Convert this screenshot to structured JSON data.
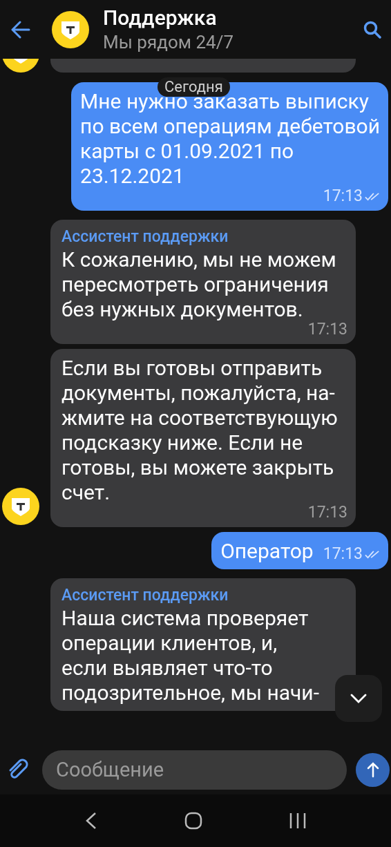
{
  "header": {
    "title": "Поддержка",
    "subtitle": "Мы рядом 24/7"
  },
  "date_divider": "Сегодня",
  "messages": [
    {
      "kind": "partial",
      "avatar": true
    },
    {
      "kind": "outgoing",
      "text": "Мне нужно заказать выписку\nпо всем операциям дебетовой\nкарты с 01.09.2021 по\n23.12.2021",
      "time": "17:13",
      "read": true
    },
    {
      "kind": "incoming",
      "sender": "Ассистент поддержки",
      "text": "К сожалению, мы не можем\nпересмотреть ограничения\nбез нужных документов.",
      "time": "17:13",
      "avatar": false
    },
    {
      "kind": "incoming",
      "text": "Если вы готовы отправить\nдокументы, пожалуйста, на-\nжмите на соответствующую\nподсказку ниже. Если не\nготовы, вы можете закрыть\nсчет.",
      "time": "17:13",
      "avatar": true
    },
    {
      "kind": "outgoing",
      "text": "Оператор",
      "time": "17:13",
      "read": true
    },
    {
      "kind": "incoming",
      "sender": "Ассистент поддержки",
      "text": "Наша система проверяет\nоперации клиентов, и,\nесли выявляет что-то\nподозрительное, мы начи-",
      "avatar": false
    }
  ],
  "composer": {
    "placeholder": "Сообщение"
  }
}
